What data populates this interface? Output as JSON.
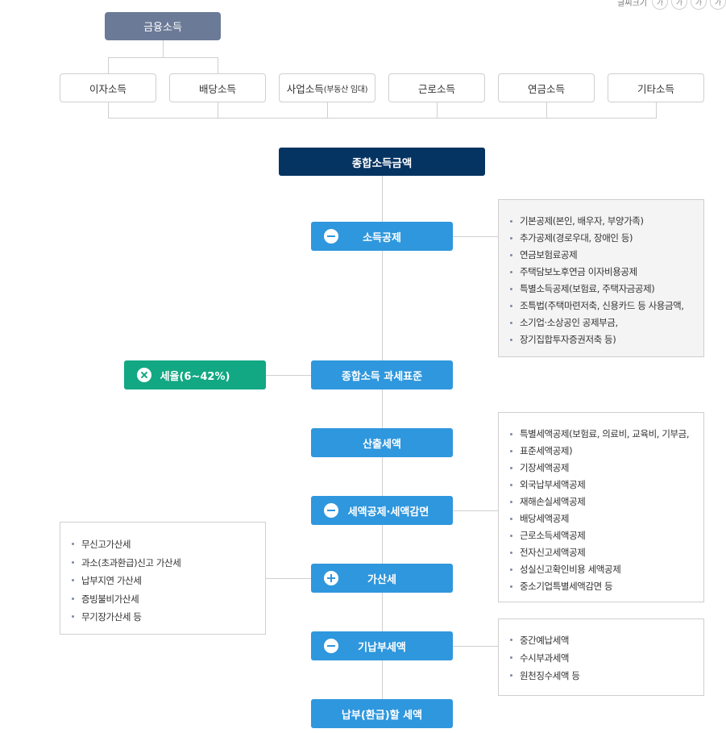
{
  "top_right": {
    "label": "글씨크기",
    "buttons": [
      "가",
      "가",
      "가",
      "가"
    ]
  },
  "financial_income": "금융소득",
  "income_types": [
    {
      "label": "이자소득",
      "sub": ""
    },
    {
      "label": "배당소득",
      "sub": ""
    },
    {
      "label": "사업소득",
      "sub": "(부동산 임대)"
    },
    {
      "label": "근로소득",
      "sub": ""
    },
    {
      "label": "연금소득",
      "sub": ""
    },
    {
      "label": "기타소득",
      "sub": ""
    }
  ],
  "total_income": "종합소득금액",
  "steps": {
    "income_deduction": "소득공제",
    "tax_base": "종합소득 과세표준",
    "computed_tax": "산출세액",
    "tax_credit": "세액공제·세액감면",
    "additional_tax": "가산세",
    "prepaid_tax": "기납부세액",
    "payable_tax": "납부(환급)할 세액"
  },
  "tax_rate": "세율(6~42%)",
  "notes": {
    "income_deduction": [
      "기본공제(본인, 배우자, 부양가족)",
      "추가공제(경로우대, 장애인 등)",
      "연금보험료공제",
      "주택담보노후연금 이자비용공제",
      "특별소득공제(보험료, 주택자금공제)",
      "조특법(주택마련저축, 신용카드 등 사용금액,",
      "소기업·소상공인 공제부금,",
      "장기집합투자증권저축 등)"
    ],
    "tax_credit": [
      "특별세액공제(보험료, 의료비, 교육비, 기부금,",
      "표준세액공제)",
      "기장세액공제",
      "외국납부세액공제",
      "재해손실세액공제",
      "배당세액공제",
      "근로소득세액공제",
      "전자신고세액공제",
      "성실신고확인비용 세액공제",
      "중소기업특별세액감면 등"
    ],
    "additional_tax": [
      "무신고가산세",
      "과소(초과환급)신고 가산세",
      "납부지연 가산세",
      "증빙불비가산세",
      "무기장가산세 등"
    ],
    "prepaid_tax": [
      "중간예납세액",
      "수시부과세액",
      "원천징수세액 등"
    ]
  }
}
